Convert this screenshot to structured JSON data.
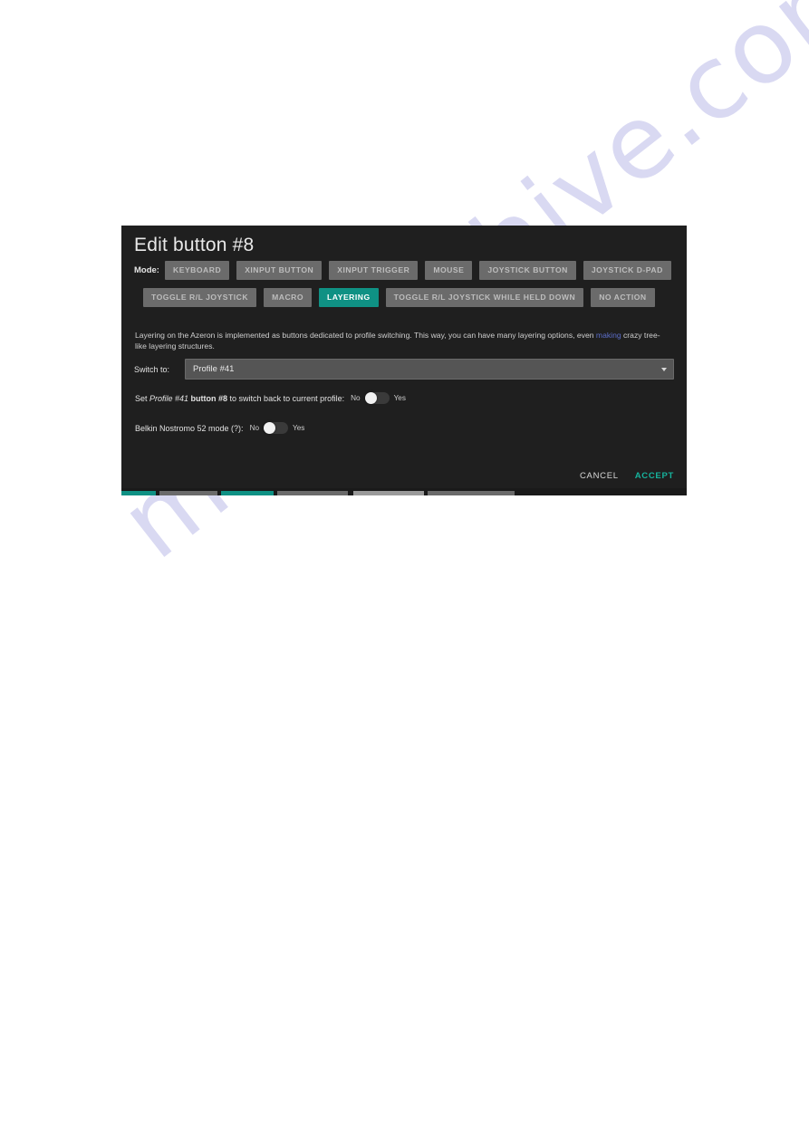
{
  "page": {
    "background_color": "#ffffff",
    "watermark_text": "manualshive.com",
    "watermark_color": "#d9d9f2"
  },
  "dialog": {
    "title": "Edit button #8",
    "background_color": "#1f1f1f",
    "accent_color": "#0f9184",
    "accept_color": "#16b39d",
    "mode": {
      "label": "Mode:",
      "selected": "LAYERING",
      "row1": [
        {
          "label": "KEYBOARD",
          "selected": false
        },
        {
          "label": "XINPUT BUTTON",
          "selected": false
        },
        {
          "label": "XINPUT TRIGGER",
          "selected": false
        },
        {
          "label": "MOUSE",
          "selected": false
        },
        {
          "label": "JOYSTICK BUTTON",
          "selected": false
        },
        {
          "label": "JOYSTICK D-PAD",
          "selected": false
        }
      ],
      "row2": [
        {
          "label": "TOGGLE R/L JOYSTICK",
          "selected": false
        },
        {
          "label": "MACRO",
          "selected": false
        },
        {
          "label": "LAYERING",
          "selected": true
        },
        {
          "label": "TOGGLE R/L JOYSTICK WHILE HELD DOWN",
          "selected": false
        },
        {
          "label": "NO ACTION",
          "selected": false
        }
      ]
    },
    "description": {
      "part1": "Layering on the Azeron is implemented as buttons dedicated to profile switching. This way, you can have many layering options, even ",
      "highlight": "making",
      "part2": " crazy tree-like layering structures."
    },
    "switch_to": {
      "label": "Switch to:",
      "value": "Profile #41",
      "arrow_icon": "chevron-down-icon"
    },
    "switchback": {
      "text_prefix": "Set ",
      "profile_name": "Profile #41",
      "text_middle": " button #8",
      "text_suffix": " to switch back to current profile:",
      "off_label": "No",
      "on_label": "Yes",
      "state": "No"
    },
    "belkin": {
      "label": "Belkin Nostromo 52 mode (?):",
      "off_label": "No",
      "on_label": "Yes",
      "state": "No"
    },
    "actions": {
      "cancel_label": "CANCEL",
      "accept_label": "ACCEPT"
    }
  }
}
